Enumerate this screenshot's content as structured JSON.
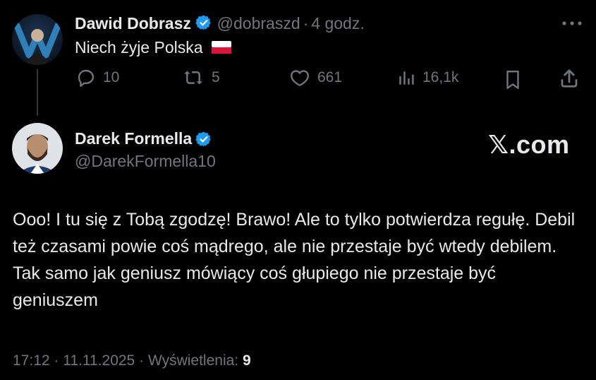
{
  "parent_tweet": {
    "author_name": "Dawid Dobrasz",
    "handle": "@dobraszd",
    "separator": "·",
    "time": "4 godz.",
    "text": "Niech żyje Polska",
    "flag": "🇵🇱",
    "more_icon": "more-horizontal-icon",
    "actions": {
      "replies": "10",
      "reposts": "5",
      "likes": "661",
      "views": "16,1k"
    }
  },
  "reply_tweet": {
    "author_name": "Darek Formella",
    "handle": "@DarekFormella10",
    "text": "Ooo! I tu się z Tobą zgodzę! Brawo! Ale to tylko potwierdza regułę. Debil też czasami powie coś mądrego, ale nie przestaje być wtedy debilem. Tak samo jak geniusz mówiący coś głupiego nie przestaje być geniuszem",
    "meta": {
      "time": "17:12",
      "date": "11.11.2025",
      "views_label": "Wyświetlenia:",
      "views_count": "9",
      "sep": "·"
    }
  },
  "watermark": "𝕏.com",
  "colors": {
    "background": "#000000",
    "text": "#e7e9ea",
    "muted": "#71767b",
    "verified": "#1d9bf0"
  }
}
